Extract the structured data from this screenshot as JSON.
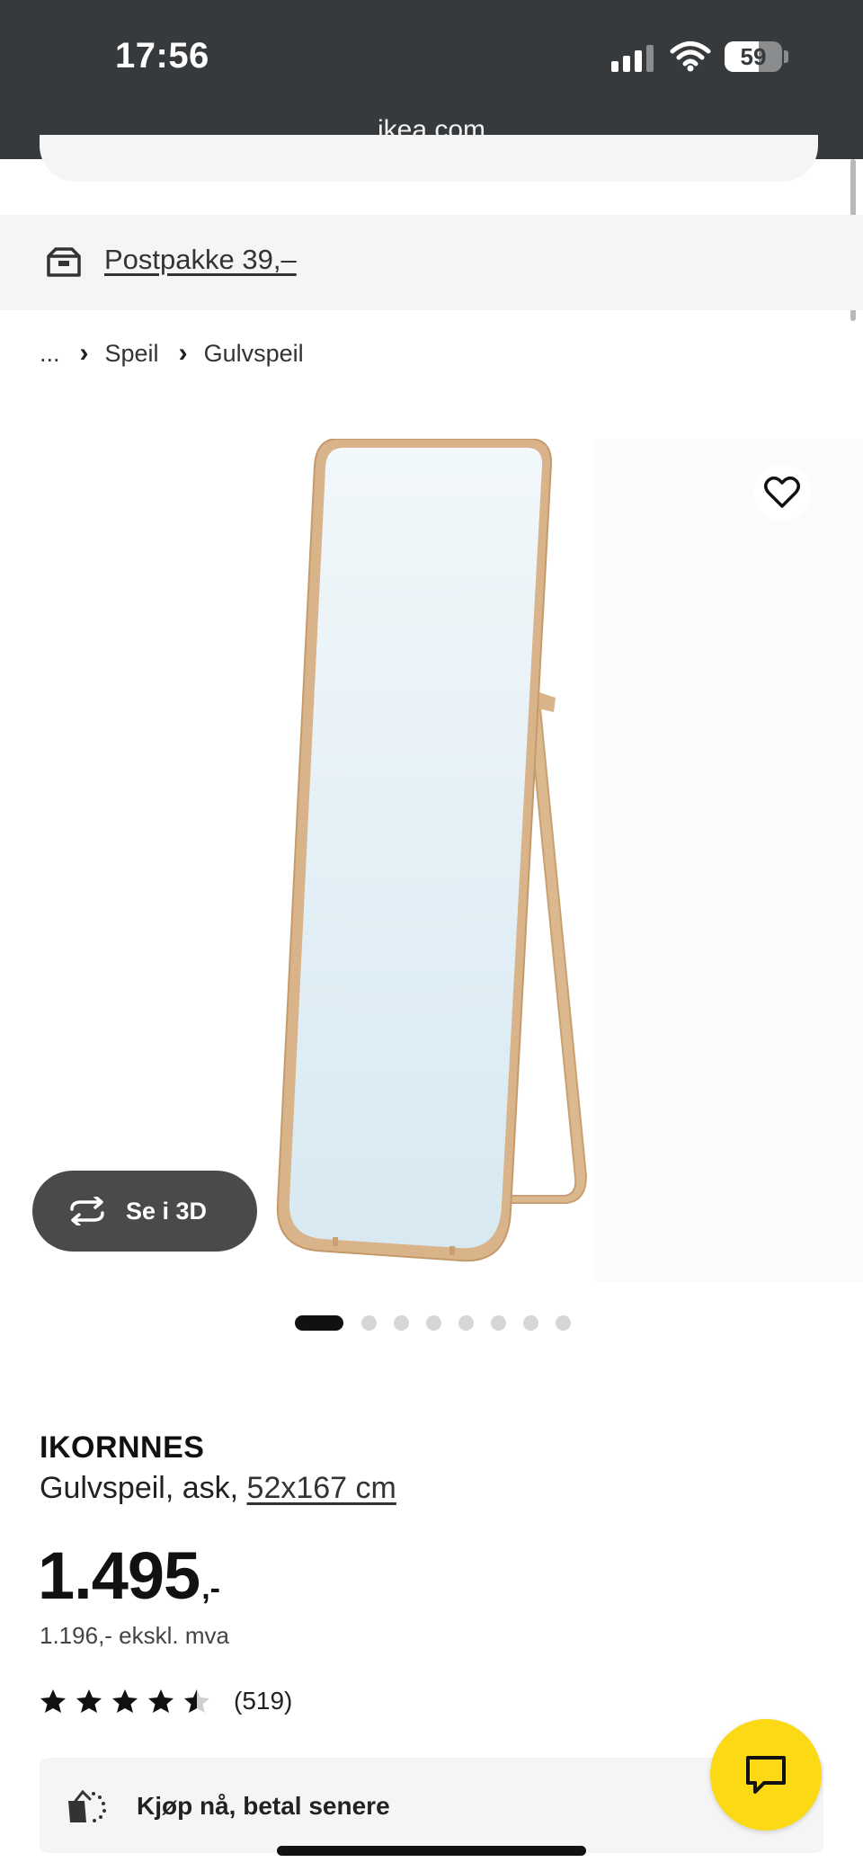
{
  "status_bar": {
    "time": "17:56",
    "battery": "59",
    "url": "ikea.com"
  },
  "delivery": {
    "label": "Postpakke 39,–",
    "icon": "delivery-box-icon"
  },
  "breadcrumb": {
    "ellipsis": "...",
    "items": [
      "Speil",
      "Gulvspeil"
    ]
  },
  "gallery": {
    "view_3d_label": "Se i 3D",
    "total_images": 8,
    "active_index": 0
  },
  "product": {
    "name": "IKORNNES",
    "description_prefix": "Gulvspeil, ask, ",
    "size": "52x167 cm",
    "price": "1.495",
    "price_suffix": ",-",
    "price_ex_vat": "1.196,- ekskl. mva",
    "rating": 4.5,
    "rating_max": 5,
    "rating_count": "(519)"
  },
  "financing": {
    "label": "Kjøp nå, betal senere"
  },
  "colors": {
    "status_bar": "#373a3c",
    "chat_button": "#fbd914",
    "mirror_frame": "#d9b48a",
    "mirror_glass": "#deedf5"
  }
}
